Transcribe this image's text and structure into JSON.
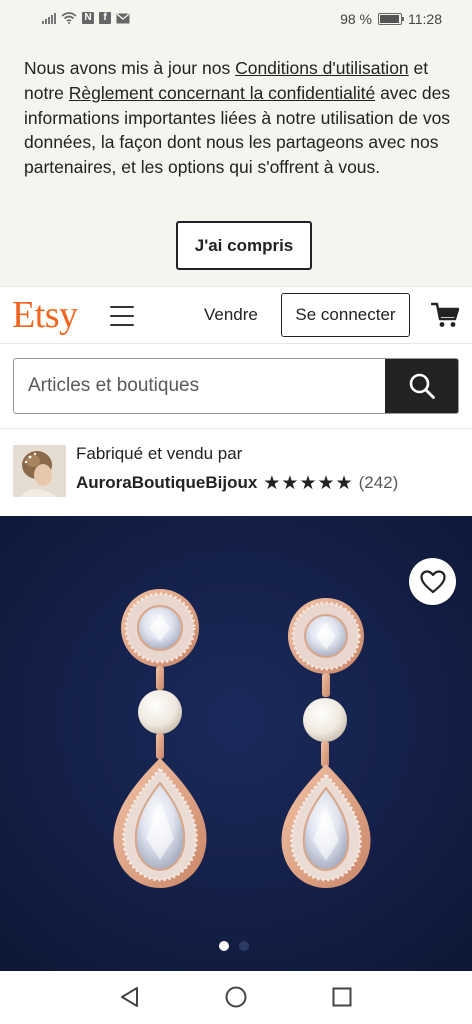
{
  "status_bar": {
    "battery": "98 %",
    "time": "11:28",
    "icons": [
      "signal-icon",
      "wifi-icon",
      "nfc-icon",
      "facebook-icon",
      "mail-icon",
      "battery-icon"
    ]
  },
  "notice": {
    "text_1": "Nous avons mis à jour nos ",
    "link_terms": "Conditions d'utilisation",
    "text_2": " et notre ",
    "link_privacy": "Règlement concernant la confidentialité",
    "text_3": " avec des informations importantes liées à notre utilisation de vos données, la façon dont nous les partageons avec nos partenaires, et les options qui s'offrent à vous.",
    "button": "J'ai compris"
  },
  "header": {
    "logo": "Etsy",
    "sell": "Vendre",
    "sign_in": "Se connecter",
    "brand_color": "#f1641e"
  },
  "search": {
    "placeholder": "Articles et boutiques"
  },
  "shop": {
    "made_by": "Fabriqué et vendu par",
    "name": "AuroraBoutiqueBijoux",
    "rating": 5,
    "reviews": "(242)"
  },
  "product": {
    "image_index": 1,
    "image_count": 2,
    "favorited": false
  },
  "nav": {
    "icons": [
      "back-icon",
      "home-icon",
      "recents-icon"
    ]
  }
}
